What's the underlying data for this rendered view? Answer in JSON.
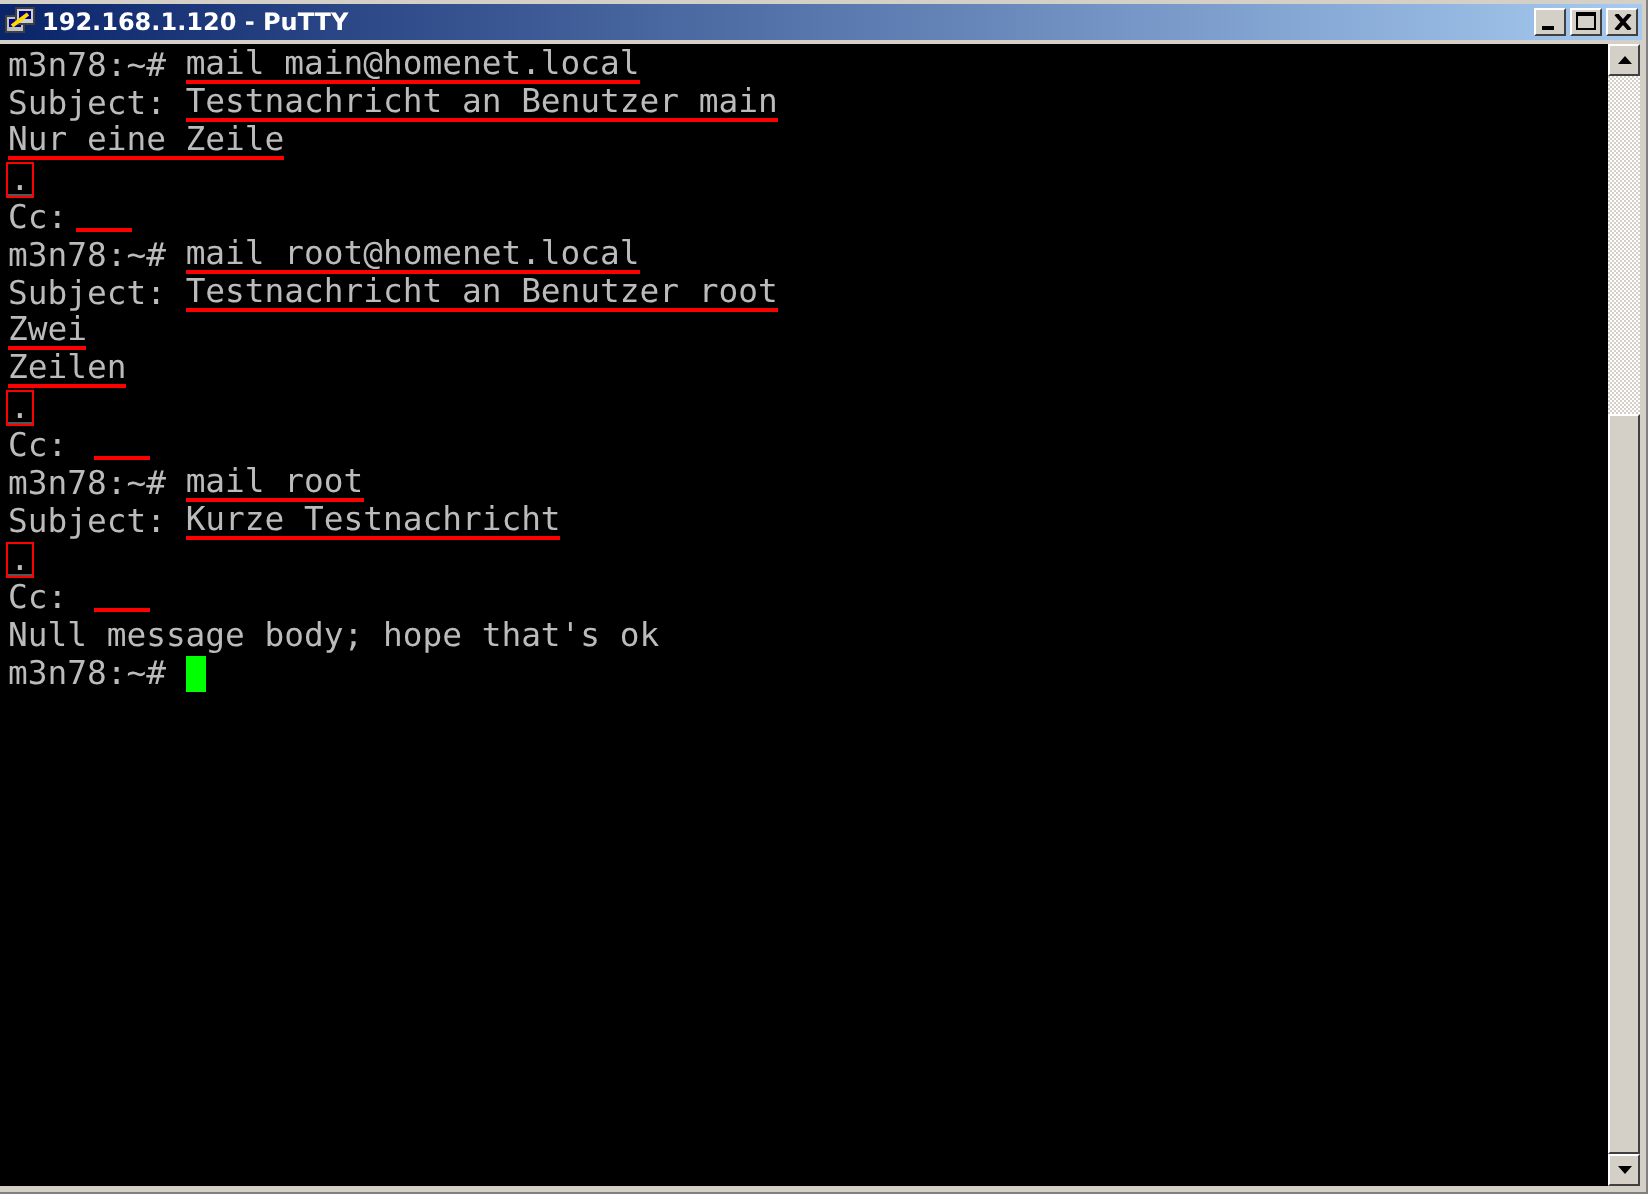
{
  "window": {
    "title": "192.168.1.120 - PuTTY"
  },
  "lines": [
    {
      "prompt": "m3n78:~# ",
      "input": "mail main@homenet.local",
      "kind": "underlined"
    },
    {
      "prompt": "Subject: ",
      "input": "Testnachricht an Benutzer main",
      "kind": "underlined"
    },
    {
      "input": "Nur eine Zeile",
      "kind": "underlined"
    },
    {
      "input": ".",
      "kind": "boxed"
    },
    {
      "prompt": "Cc:",
      "kind": "blank"
    },
    {
      "prompt": "m3n78:~# ",
      "input": "mail root@homenet.local",
      "kind": "underlined"
    },
    {
      "prompt": "Subject: ",
      "input": "Testnachricht an Benutzer root",
      "kind": "underlined"
    },
    {
      "input": "Zwei",
      "kind": "underlined"
    },
    {
      "input": "Zeilen",
      "kind": "underlined"
    },
    {
      "input": ".",
      "kind": "boxed"
    },
    {
      "prompt": "Cc: ",
      "kind": "blank"
    },
    {
      "prompt": "m3n78:~# ",
      "input": "mail root",
      "kind": "underlined"
    },
    {
      "prompt": "Subject: ",
      "input": "Kurze Testnachricht",
      "kind": "underlined"
    },
    {
      "input": ".",
      "kind": "boxed"
    },
    {
      "prompt": "Cc: ",
      "kind": "blank"
    },
    {
      "prompt": "Null message body; hope that's ok",
      "kind": "plain"
    },
    {
      "prompt": "m3n78:~# ",
      "kind": "cursor"
    }
  ]
}
